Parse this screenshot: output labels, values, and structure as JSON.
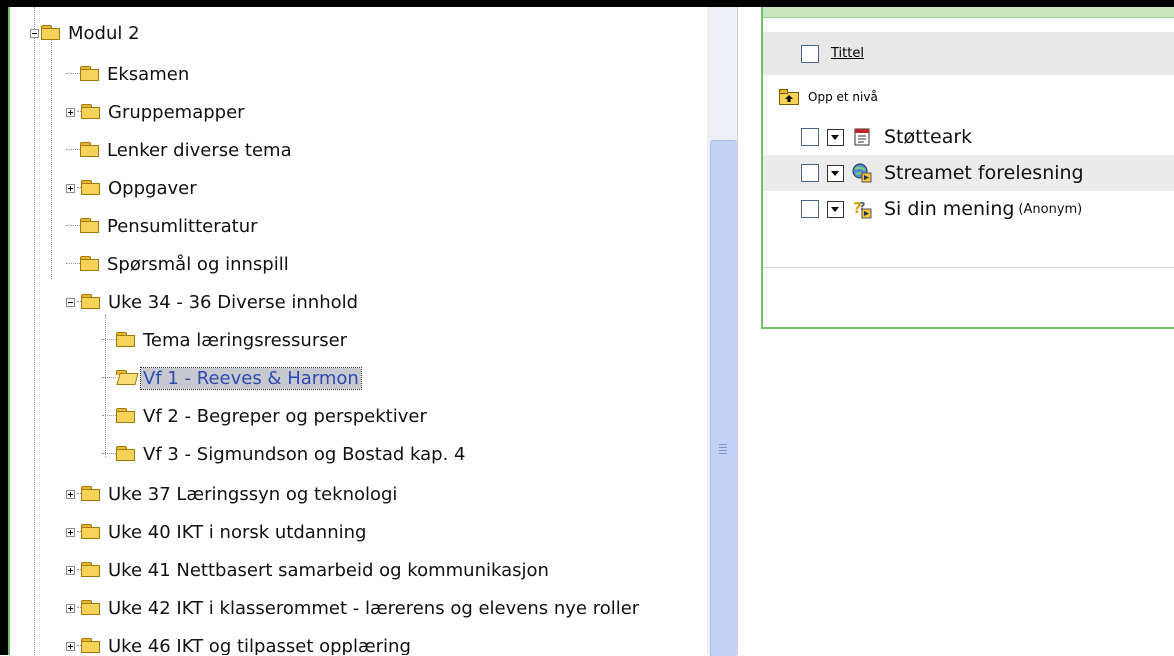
{
  "tree": {
    "items": [
      {
        "label": "Modul 2",
        "expander": "minus"
      },
      {
        "label": "Eksamen"
      },
      {
        "label": "Gruppemapper",
        "expander": "plus"
      },
      {
        "label": "Lenker diverse tema"
      },
      {
        "label": "Oppgaver",
        "expander": "plus"
      },
      {
        "label": "Pensumlitteratur"
      },
      {
        "label": "Spørsmål og innspill"
      },
      {
        "label": "Uke 34 - 36 Diverse innhold",
        "expander": "minus"
      },
      {
        "label": "Tema læringsressurser"
      },
      {
        "label": "Vf 1 - Reeves & Harmon",
        "selected": true
      },
      {
        "label": "Vf 2 - Begreper og perspektiver"
      },
      {
        "label": "Vf 3 - Sigmundson og Bostad kap. 4"
      },
      {
        "label": "Uke 37 Læringssyn og teknologi",
        "expander": "plus"
      },
      {
        "label": "Uke 40 IKT i norsk utdanning",
        "expander": "plus"
      },
      {
        "label": "Uke 41 Nettbasert samarbeid og kommunikasjon",
        "expander": "plus"
      },
      {
        "label": "Uke 42 IKT i klasserommet - lærerens og elevens nye roller",
        "expander": "plus"
      },
      {
        "label": "Uke 46 IKT og tilpasset opplæring",
        "expander": "plus"
      }
    ]
  },
  "content": {
    "column_title": "Tittel",
    "up_level": "Opp et nivå",
    "items": [
      {
        "title": "Støtteark",
        "icon": "document-icon"
      },
      {
        "title": "Streamet forelesning",
        "icon": "stream-icon"
      },
      {
        "title": "Si din mening",
        "note": "(Anonym)",
        "icon": "survey-icon"
      }
    ]
  }
}
